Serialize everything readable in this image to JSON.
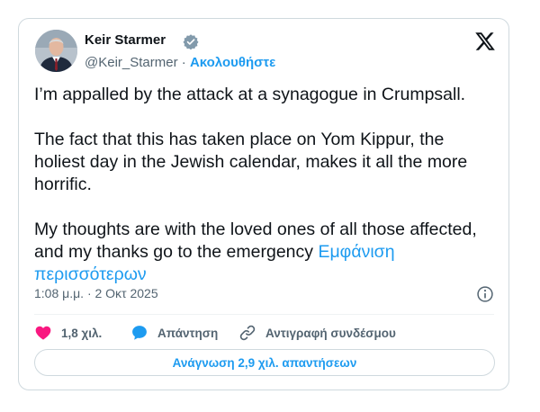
{
  "author": {
    "name": "Keir Starmer",
    "handle": "@Keir_Starmer",
    "separator": "·",
    "follow_label": "Ακολουθήστε"
  },
  "post": {
    "paragraphs": [
      "I’m appalled by the attack at a synagogue in Crumpsall.",
      "The fact that this has taken place on Yom Kippur, the holiest day in the Jewish calendar, makes it all the more horrific.",
      "My thoughts are with the loved ones of all those affected, and my thanks go to the emergency"
    ],
    "show_more_label": "Εμφάνιση περισσότερων",
    "timestamp": "1:08 μ.μ. · 2 Οκτ 2025"
  },
  "actions": {
    "like_count": "1,8 χιλ.",
    "reply_label": "Απάντηση",
    "copy_link_label": "Αντιγραφή συνδέσμου"
  },
  "read_replies_label": "Ανάγνωση 2,9 χιλ. απαντήσεων",
  "icons": [
    "verified-badge-icon",
    "x-logo-icon",
    "info-icon",
    "heart-icon",
    "reply-bubble-icon",
    "link-icon"
  ],
  "colors": {
    "accent": "#1d9bf0",
    "like": "#f91880",
    "text": "#0f1419",
    "muted": "#536471",
    "border": "#cfd9de"
  }
}
